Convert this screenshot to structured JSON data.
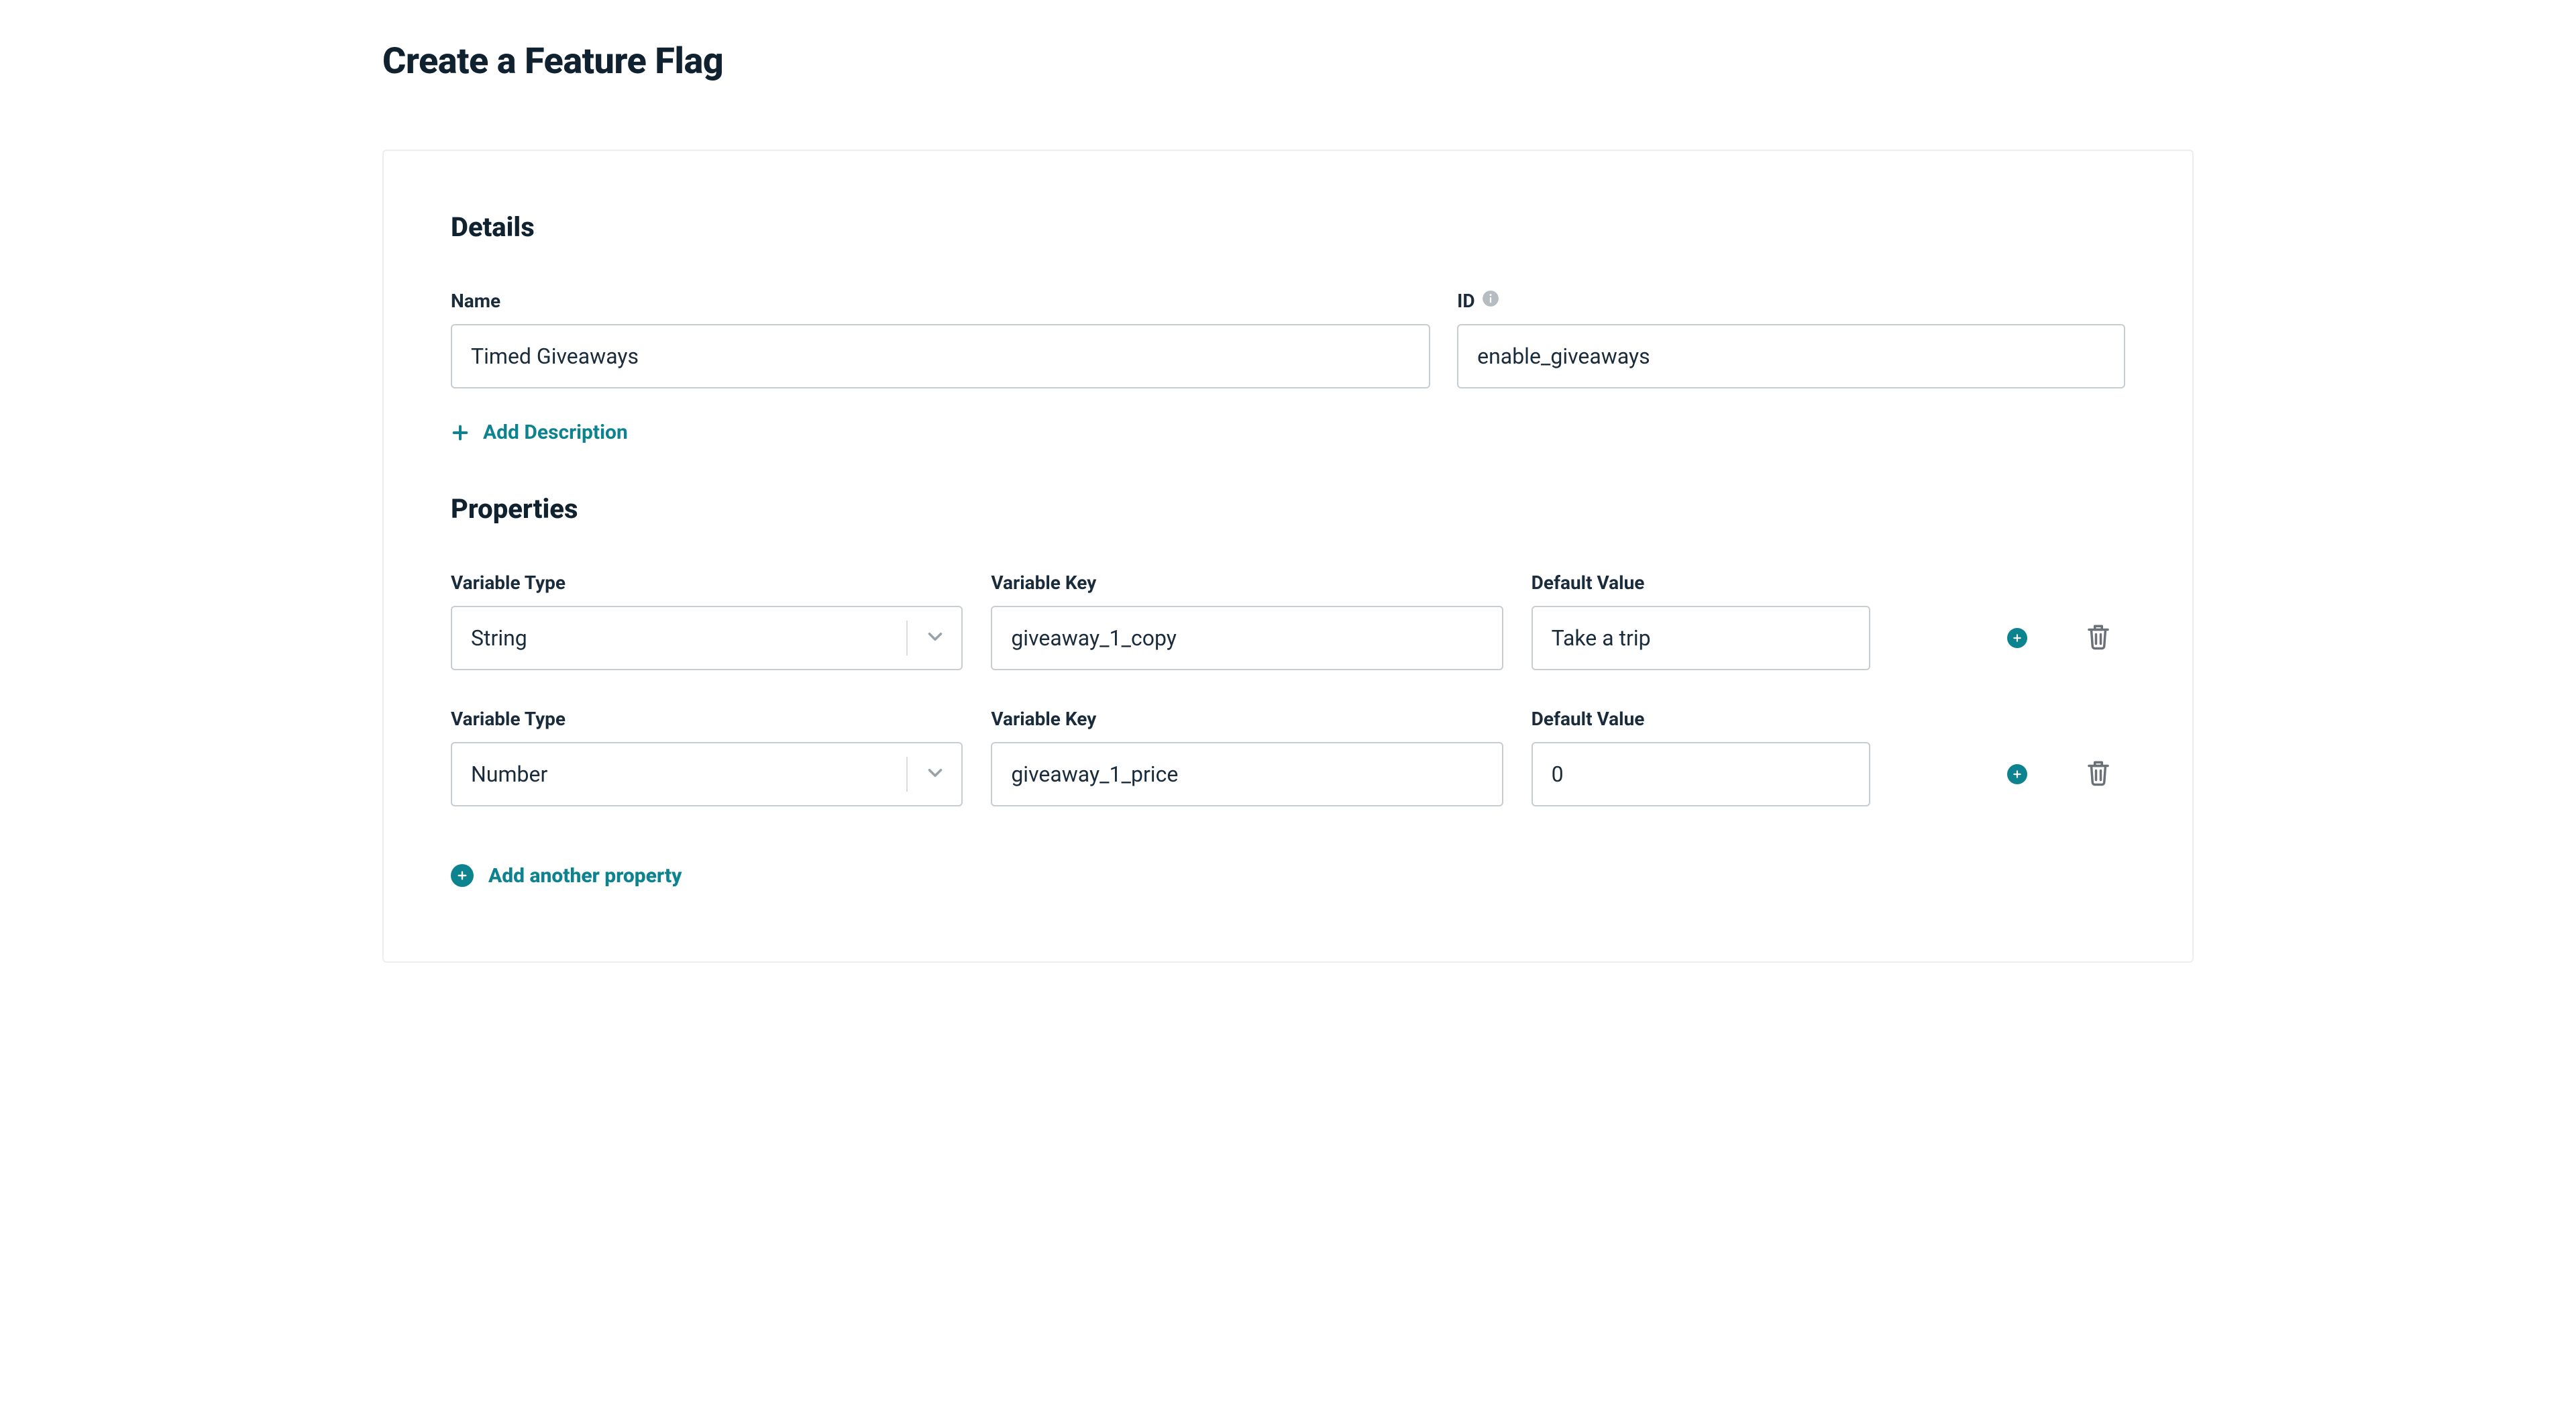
{
  "page_title": "Create a Feature Flag",
  "sections": {
    "details_title": "Details",
    "properties_title": "Properties"
  },
  "details": {
    "name_label": "Name",
    "id_label": "ID",
    "name_value": "Timed Giveaways",
    "id_value": "enable_giveaways",
    "add_description_label": "Add Description"
  },
  "properties_labels": {
    "type_label": "Variable Type",
    "key_label": "Variable Key",
    "value_label": "Default Value"
  },
  "properties": [
    {
      "type": "String",
      "key": "giveaway_1_copy",
      "value": "Take a trip"
    },
    {
      "type": "Number",
      "key": "giveaway_1_price",
      "value": "0"
    }
  ],
  "add_property_label": "Add another property"
}
